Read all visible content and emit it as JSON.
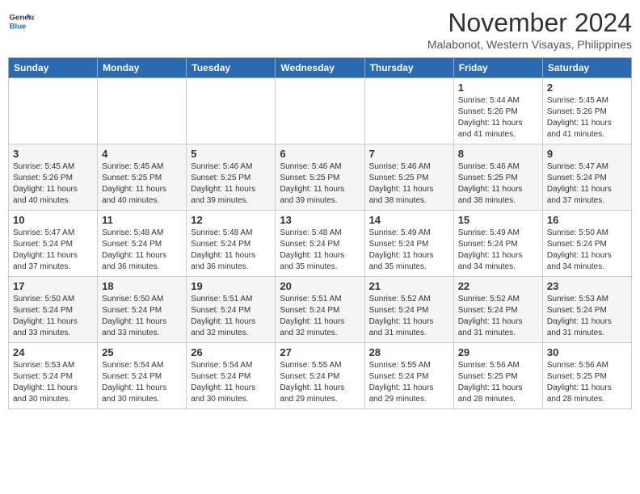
{
  "header": {
    "logo_line1": "General",
    "logo_line2": "Blue",
    "month": "November 2024",
    "location": "Malabonot, Western Visayas, Philippines"
  },
  "weekdays": [
    "Sunday",
    "Monday",
    "Tuesday",
    "Wednesday",
    "Thursday",
    "Friday",
    "Saturday"
  ],
  "weeks": [
    [
      {
        "day": "",
        "info": ""
      },
      {
        "day": "",
        "info": ""
      },
      {
        "day": "",
        "info": ""
      },
      {
        "day": "",
        "info": ""
      },
      {
        "day": "",
        "info": ""
      },
      {
        "day": "1",
        "info": "Sunrise: 5:44 AM\nSunset: 5:26 PM\nDaylight: 11 hours and 41 minutes."
      },
      {
        "day": "2",
        "info": "Sunrise: 5:45 AM\nSunset: 5:26 PM\nDaylight: 11 hours and 41 minutes."
      }
    ],
    [
      {
        "day": "3",
        "info": "Sunrise: 5:45 AM\nSunset: 5:26 PM\nDaylight: 11 hours and 40 minutes."
      },
      {
        "day": "4",
        "info": "Sunrise: 5:45 AM\nSunset: 5:25 PM\nDaylight: 11 hours and 40 minutes."
      },
      {
        "day": "5",
        "info": "Sunrise: 5:46 AM\nSunset: 5:25 PM\nDaylight: 11 hours and 39 minutes."
      },
      {
        "day": "6",
        "info": "Sunrise: 5:46 AM\nSunset: 5:25 PM\nDaylight: 11 hours and 39 minutes."
      },
      {
        "day": "7",
        "info": "Sunrise: 5:46 AM\nSunset: 5:25 PM\nDaylight: 11 hours and 38 minutes."
      },
      {
        "day": "8",
        "info": "Sunrise: 5:46 AM\nSunset: 5:25 PM\nDaylight: 11 hours and 38 minutes."
      },
      {
        "day": "9",
        "info": "Sunrise: 5:47 AM\nSunset: 5:24 PM\nDaylight: 11 hours and 37 minutes."
      }
    ],
    [
      {
        "day": "10",
        "info": "Sunrise: 5:47 AM\nSunset: 5:24 PM\nDaylight: 11 hours and 37 minutes."
      },
      {
        "day": "11",
        "info": "Sunrise: 5:48 AM\nSunset: 5:24 PM\nDaylight: 11 hours and 36 minutes."
      },
      {
        "day": "12",
        "info": "Sunrise: 5:48 AM\nSunset: 5:24 PM\nDaylight: 11 hours and 36 minutes."
      },
      {
        "day": "13",
        "info": "Sunrise: 5:48 AM\nSunset: 5:24 PM\nDaylight: 11 hours and 35 minutes."
      },
      {
        "day": "14",
        "info": "Sunrise: 5:49 AM\nSunset: 5:24 PM\nDaylight: 11 hours and 35 minutes."
      },
      {
        "day": "15",
        "info": "Sunrise: 5:49 AM\nSunset: 5:24 PM\nDaylight: 11 hours and 34 minutes."
      },
      {
        "day": "16",
        "info": "Sunrise: 5:50 AM\nSunset: 5:24 PM\nDaylight: 11 hours and 34 minutes."
      }
    ],
    [
      {
        "day": "17",
        "info": "Sunrise: 5:50 AM\nSunset: 5:24 PM\nDaylight: 11 hours and 33 minutes."
      },
      {
        "day": "18",
        "info": "Sunrise: 5:50 AM\nSunset: 5:24 PM\nDaylight: 11 hours and 33 minutes."
      },
      {
        "day": "19",
        "info": "Sunrise: 5:51 AM\nSunset: 5:24 PM\nDaylight: 11 hours and 32 minutes."
      },
      {
        "day": "20",
        "info": "Sunrise: 5:51 AM\nSunset: 5:24 PM\nDaylight: 11 hours and 32 minutes."
      },
      {
        "day": "21",
        "info": "Sunrise: 5:52 AM\nSunset: 5:24 PM\nDaylight: 11 hours and 31 minutes."
      },
      {
        "day": "22",
        "info": "Sunrise: 5:52 AM\nSunset: 5:24 PM\nDaylight: 11 hours and 31 minutes."
      },
      {
        "day": "23",
        "info": "Sunrise: 5:53 AM\nSunset: 5:24 PM\nDaylight: 11 hours and 31 minutes."
      }
    ],
    [
      {
        "day": "24",
        "info": "Sunrise: 5:53 AM\nSunset: 5:24 PM\nDaylight: 11 hours and 30 minutes."
      },
      {
        "day": "25",
        "info": "Sunrise: 5:54 AM\nSunset: 5:24 PM\nDaylight: 11 hours and 30 minutes."
      },
      {
        "day": "26",
        "info": "Sunrise: 5:54 AM\nSunset: 5:24 PM\nDaylight: 11 hours and 30 minutes."
      },
      {
        "day": "27",
        "info": "Sunrise: 5:55 AM\nSunset: 5:24 PM\nDaylight: 11 hours and 29 minutes."
      },
      {
        "day": "28",
        "info": "Sunrise: 5:55 AM\nSunset: 5:24 PM\nDaylight: 11 hours and 29 minutes."
      },
      {
        "day": "29",
        "info": "Sunrise: 5:56 AM\nSunset: 5:25 PM\nDaylight: 11 hours and 28 minutes."
      },
      {
        "day": "30",
        "info": "Sunrise: 5:56 AM\nSunset: 5:25 PM\nDaylight: 11 hours and 28 minutes."
      }
    ]
  ]
}
